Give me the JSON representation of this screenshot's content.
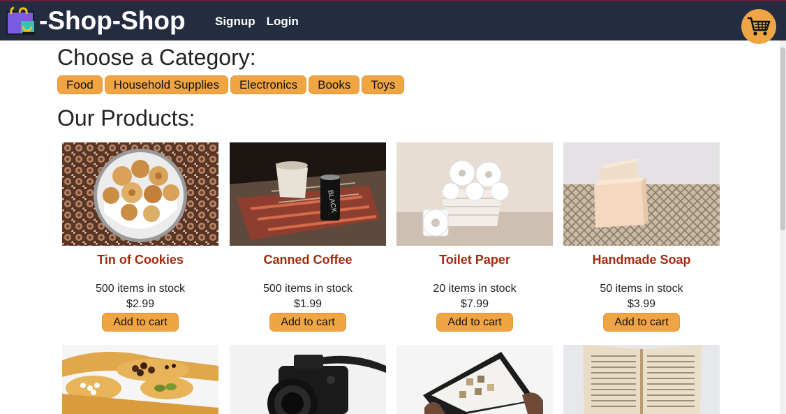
{
  "header": {
    "brand_title": "-Shop-Shop",
    "nav": [
      {
        "label": "Signup"
      },
      {
        "label": "Login"
      }
    ],
    "cart_icon": "shopping-cart-icon"
  },
  "categories": {
    "heading": "Choose a Category:",
    "items": [
      {
        "label": "Food"
      },
      {
        "label": "Household Supplies"
      },
      {
        "label": "Electronics"
      },
      {
        "label": "Books"
      },
      {
        "label": "Toys"
      }
    ]
  },
  "products": {
    "heading": "Our Products:",
    "items": [
      {
        "name": "Tin of Cookies",
        "stock": "500 items in stock",
        "price": "$2.99",
        "button": "Add to cart"
      },
      {
        "name": "Canned Coffee",
        "stock": "500 items in stock",
        "price": "$1.99",
        "button": "Add to cart"
      },
      {
        "name": "Toilet Paper",
        "stock": "20 items in stock",
        "price": "$7.99",
        "button": "Add to cart"
      },
      {
        "name": "Handmade Soap",
        "stock": "50 items in stock",
        "price": "$3.99",
        "button": "Add to cart"
      }
    ]
  },
  "colors": {
    "navbar": "#232d3f",
    "accent": "#f0a545",
    "product_name": "#a52a0f"
  }
}
